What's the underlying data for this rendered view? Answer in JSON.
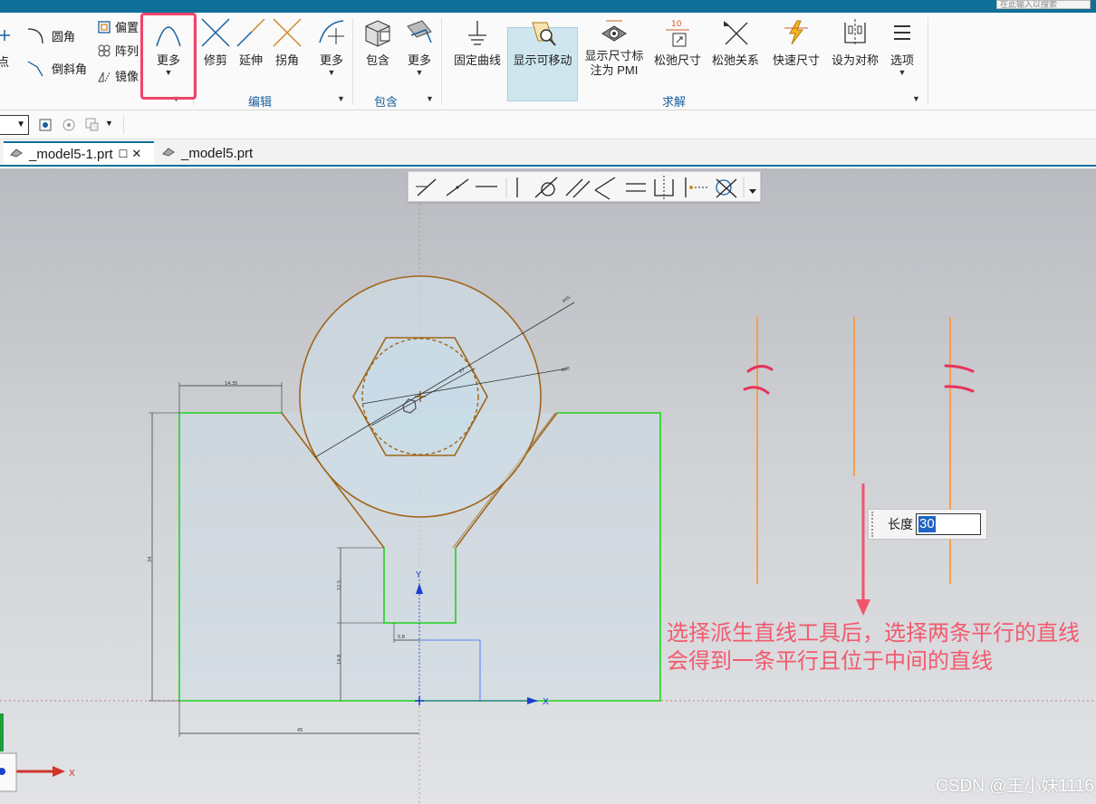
{
  "search": {
    "placeholder": "在此输入以搜索"
  },
  "ribbon": {
    "left_partial": {
      "point_label": "点",
      "fillet_label": "圆角",
      "chamfer_label": "倒斜角"
    },
    "curve_small": {
      "offset_label": "偏置",
      "pattern_label": "阵列",
      "mirror_label": "镜像"
    },
    "more_curve_label": "更多",
    "edit": {
      "trim_label": "修剪",
      "extend_label": "延伸",
      "corner_label": "拐角",
      "more_label": "更多",
      "group_label": "编辑"
    },
    "include": {
      "include_label": "包含",
      "more_label": "更多",
      "group_label": "包含"
    },
    "solve": {
      "fix_curve_label": "固定曲线",
      "show_movable_label": "显示可移动",
      "show_dim_label_1": "显示尺寸标",
      "show_dim_label_2": "注为 PMI",
      "relax_dim_label": "松弛尺寸",
      "relax_rel_label": "松弛关系",
      "quick_dim_label": "快速尺寸",
      "symmetric_label": "设为对称",
      "options_label": "选项",
      "group_label": "求解",
      "relax_dim_value": "10"
    }
  },
  "tabs": [
    {
      "label": "_model5-1.prt",
      "active": true
    },
    {
      "label": "_model5.prt",
      "active": false
    }
  ],
  "length_input": {
    "label": "长度",
    "value": "30"
  },
  "annotation": {
    "line1": "选择派生直线工具后，选择两条平行的直线",
    "line2": "会得到一条平行且位于中间的直线"
  },
  "watermark": "CSDN @王小妹1116",
  "axes": {
    "y": "Y",
    "x": "X",
    "triad_x": "X"
  },
  "colors": {
    "title_bar": "#0f6f99",
    "highlight": "#f0436a",
    "sketch_green": "#1fd21f",
    "curve_brown": "#a0651a",
    "derived_orange": "#f5a04a",
    "annotation_red": "#f25a6e"
  }
}
